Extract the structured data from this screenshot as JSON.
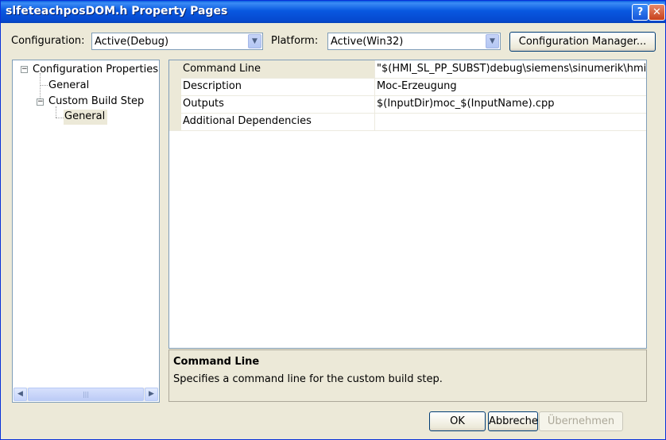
{
  "window": {
    "title": "slfeteachposDOM.h Property Pages",
    "help_glyph": "?",
    "close_glyph": "✕"
  },
  "toolbar": {
    "configuration_label": "Configuration:",
    "configuration_value": "Active(Debug)",
    "platform_label": "Platform:",
    "platform_value": "Active(Win32)",
    "config_manager_label": "Configuration Manager..."
  },
  "tree": {
    "root": {
      "label": "Configuration Properties",
      "expanded": true
    },
    "general": {
      "label": "General"
    },
    "custom_build": {
      "label": "Custom Build Step",
      "expanded": true
    },
    "custom_build_general": {
      "label": "General",
      "selected": true
    }
  },
  "grid": {
    "rows": [
      {
        "name": "Command Line",
        "value": "\"$(HMI_SL_PP_SUBST)debug\\siemens\\sinumerik\\hmi\\"
      },
      {
        "name": "Description",
        "value": "Moc-Erzeugung"
      },
      {
        "name": "Outputs",
        "value": "$(InputDir)moc_$(InputName).cpp"
      },
      {
        "name": "Additional Dependencies",
        "value": ""
      }
    ]
  },
  "description": {
    "title": "Command Line",
    "text": "Specifies a command line for the custom build step."
  },
  "buttons": {
    "ok": "OK",
    "cancel": "Abbrechen",
    "apply": "Übernehmen"
  },
  "colors": {
    "titlebar": "#0858e0",
    "dialog_bg": "#ece9d8",
    "border": "#7f9db9"
  }
}
